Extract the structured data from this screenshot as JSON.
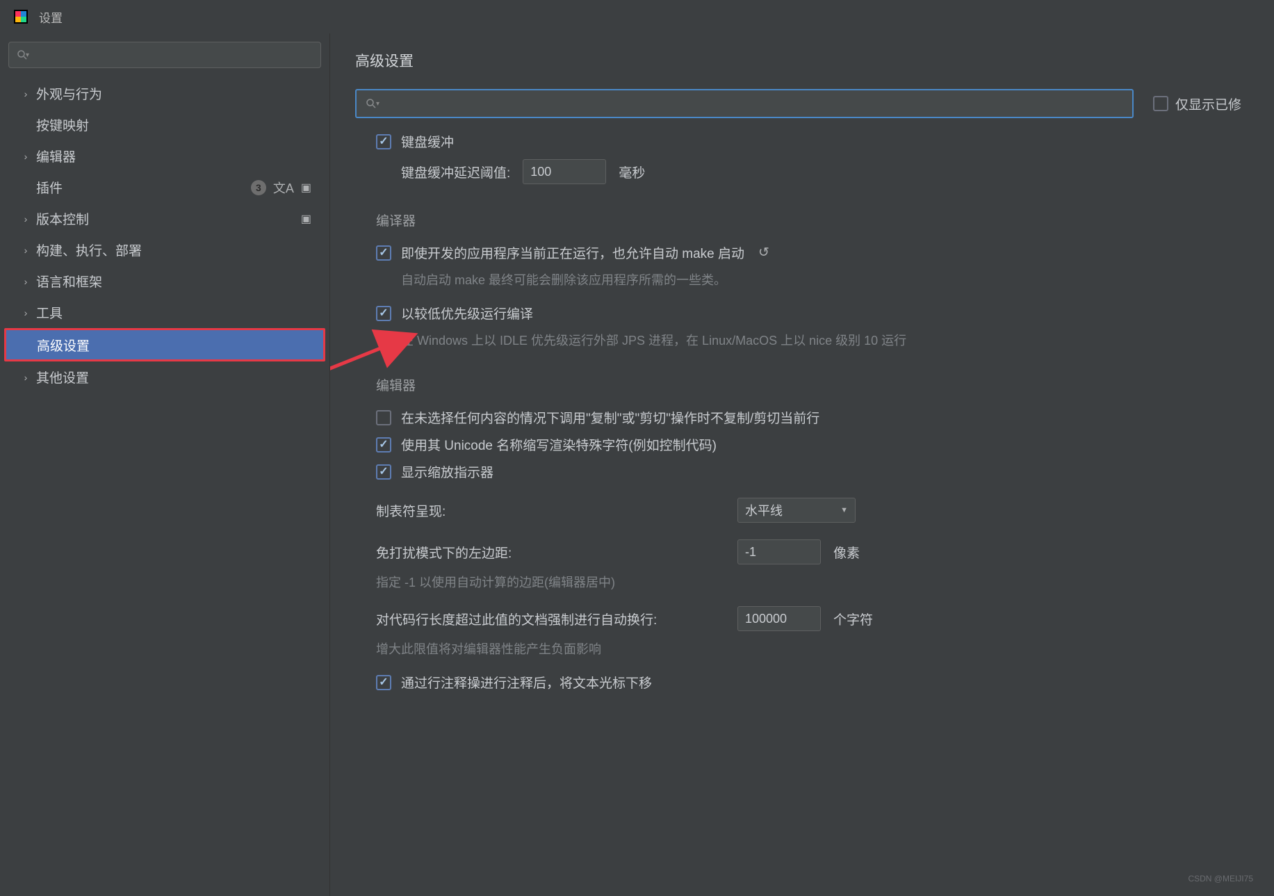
{
  "window": {
    "title": "设置"
  },
  "sidebar": {
    "items": [
      {
        "label": "外观与行为",
        "expandable": true
      },
      {
        "label": "按键映射",
        "expandable": false
      },
      {
        "label": "编辑器",
        "expandable": true
      },
      {
        "label": "插件",
        "expandable": false,
        "badge": "3",
        "icons": [
          "lang",
          "box"
        ]
      },
      {
        "label": "版本控制",
        "expandable": true,
        "icons": [
          "box"
        ]
      },
      {
        "label": "构建、执行、部署",
        "expandable": true
      },
      {
        "label": "语言和框架",
        "expandable": true
      },
      {
        "label": "工具",
        "expandable": true
      },
      {
        "label": "高级设置",
        "expandable": false,
        "selected": true
      },
      {
        "label": "其他设置",
        "expandable": true
      }
    ]
  },
  "content": {
    "page_title": "高级设置",
    "modified_only_label": "仅显示已修",
    "sections": {
      "keyboard": {
        "buffer_label": "键盘缓冲",
        "delay_label": "键盘缓冲延迟阈值:",
        "delay_value": "100",
        "delay_unit": "毫秒"
      },
      "compiler": {
        "header": "编译器",
        "auto_make_label": "即使开发的应用程序当前正在运行，也允许自动 make 启动",
        "auto_make_desc": "自动启动 make 最终可能会删除该应用程序所需的一些类。",
        "low_priority_label": "以较低优先级运行编译",
        "low_priority_desc": "在 Windows 上以 IDLE 优先级运行外部 JPS 进程，在 Linux/MacOS 上以 nice 级别 10 运行"
      },
      "editor": {
        "header": "编辑器",
        "copy_cut_label": "在未选择任何内容的情况下调用\"复制\"或\"剪切\"操作时不复制/剪切当前行",
        "unicode_label": "使用其 Unicode 名称缩写渲染特殊字符(例如控制代码)",
        "zoom_label": "显示缩放指示器",
        "tab_render_label": "制表符呈现:",
        "tab_render_value": "水平线",
        "dnd_margin_label": "免打扰模式下的左边距:",
        "dnd_margin_value": "-1",
        "dnd_margin_unit": "像素",
        "dnd_margin_desc": "指定 -1 以使用自动计算的边距(编辑器居中)",
        "wrap_label": "对代码行长度超过此值的文档强制进行自动换行:",
        "wrap_value": "100000",
        "wrap_unit": "个字符",
        "wrap_desc": "增大此限值将对编辑器性能产生负面影响",
        "comment_label": "通过行注释操进行注释后，将文本光标下移"
      }
    }
  },
  "watermark": "CSDN @MEIJI75"
}
